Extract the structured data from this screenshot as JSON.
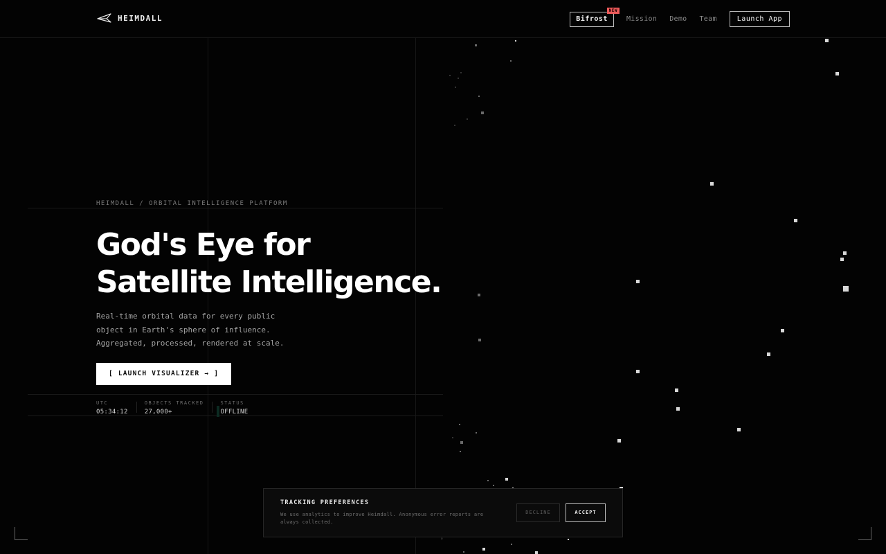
{
  "header": {
    "brand": "HEIMDALL",
    "brand_icon": "arrow-logo-icon",
    "nav": {
      "bifrost_label": "Bifrost",
      "bifrost_badge": "NEW",
      "mission_label": "Mission",
      "demo_label": "Demo",
      "team_label": "Team",
      "launch_app_label": "Launch App"
    }
  },
  "hero": {
    "eyebrow": "HEIMDALL / ORBITAL INTELLIGENCE PLATFORM",
    "headline_line1": "God's Eye for",
    "headline_line2": "Satellite Intelligence.",
    "lede_line1": "Real-time orbital data for every public",
    "lede_line2": "object in Earth's sphere of influence.",
    "lede_line3": "Aggregated, processed, rendered at scale.",
    "cta_label": "[ LAUNCH VISUALIZER → ]"
  },
  "stats": {
    "utc_label": "UTC",
    "utc_value": "05:34:12",
    "objects_label": "OBJECTS TRACKED",
    "objects_value": "27,000+",
    "status_label": "STATUS",
    "status_value": "OFFLINE"
  },
  "cookie": {
    "title": "TRACKING PREFERENCES",
    "text": "We use analytics to improve Heimdall. Anonymous error reports are always collected.",
    "decline_label": "DECLINE",
    "accept_label": "ACCEPT"
  },
  "scroll_indicator": "↓",
  "colors": {
    "background": "#030303",
    "badge": "#ef5b5b",
    "cta_bg": "#ffffff",
    "status_accent": "#0c2b22"
  }
}
